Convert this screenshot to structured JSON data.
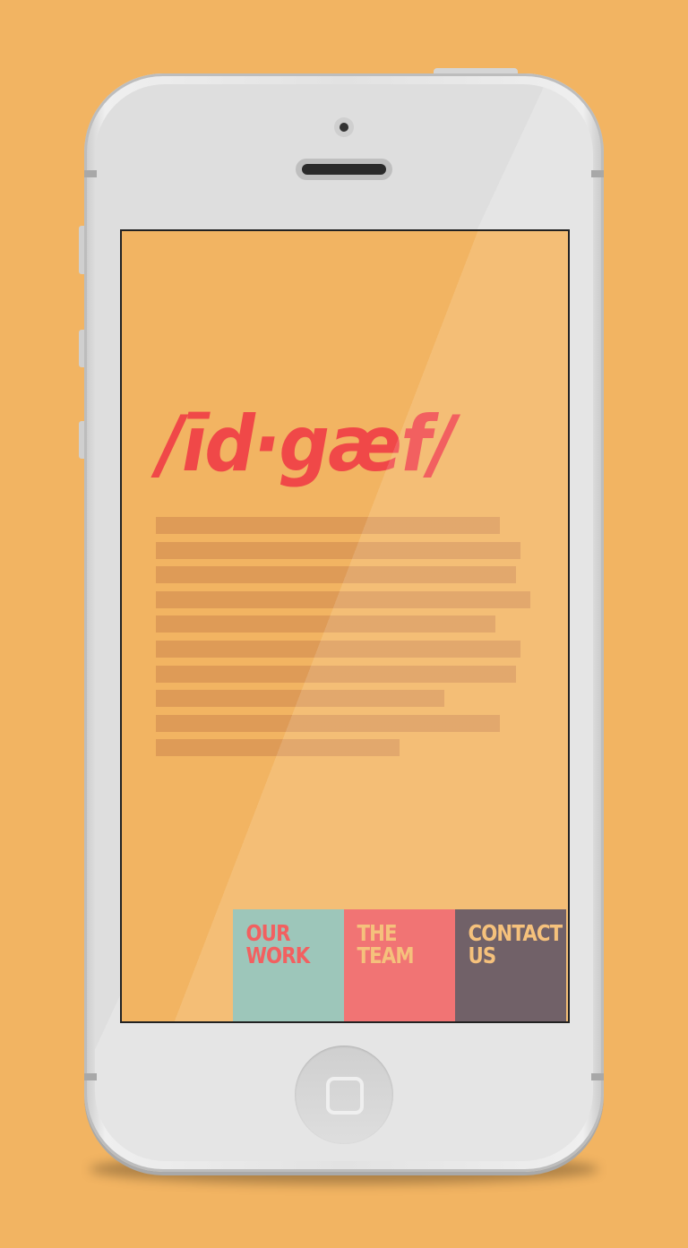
{
  "site": {
    "logo_text": "/īd·gæf/"
  },
  "nav": [
    {
      "label": "OUR\nWORK",
      "bg": "#8FBDB0",
      "color": "#F04848"
    },
    {
      "label": "THE\nTEAM",
      "bg": "#EF5F5F",
      "color": "#F4B868"
    },
    {
      "label": "CONTACT\nUS",
      "bg": "#5C4A52",
      "color": "#F4B868"
    }
  ],
  "colors": {
    "background": "#F2B462",
    "accent": "#F04848",
    "placeholder_text_bar": "#DE9B57"
  },
  "placeholder_lines": 10
}
